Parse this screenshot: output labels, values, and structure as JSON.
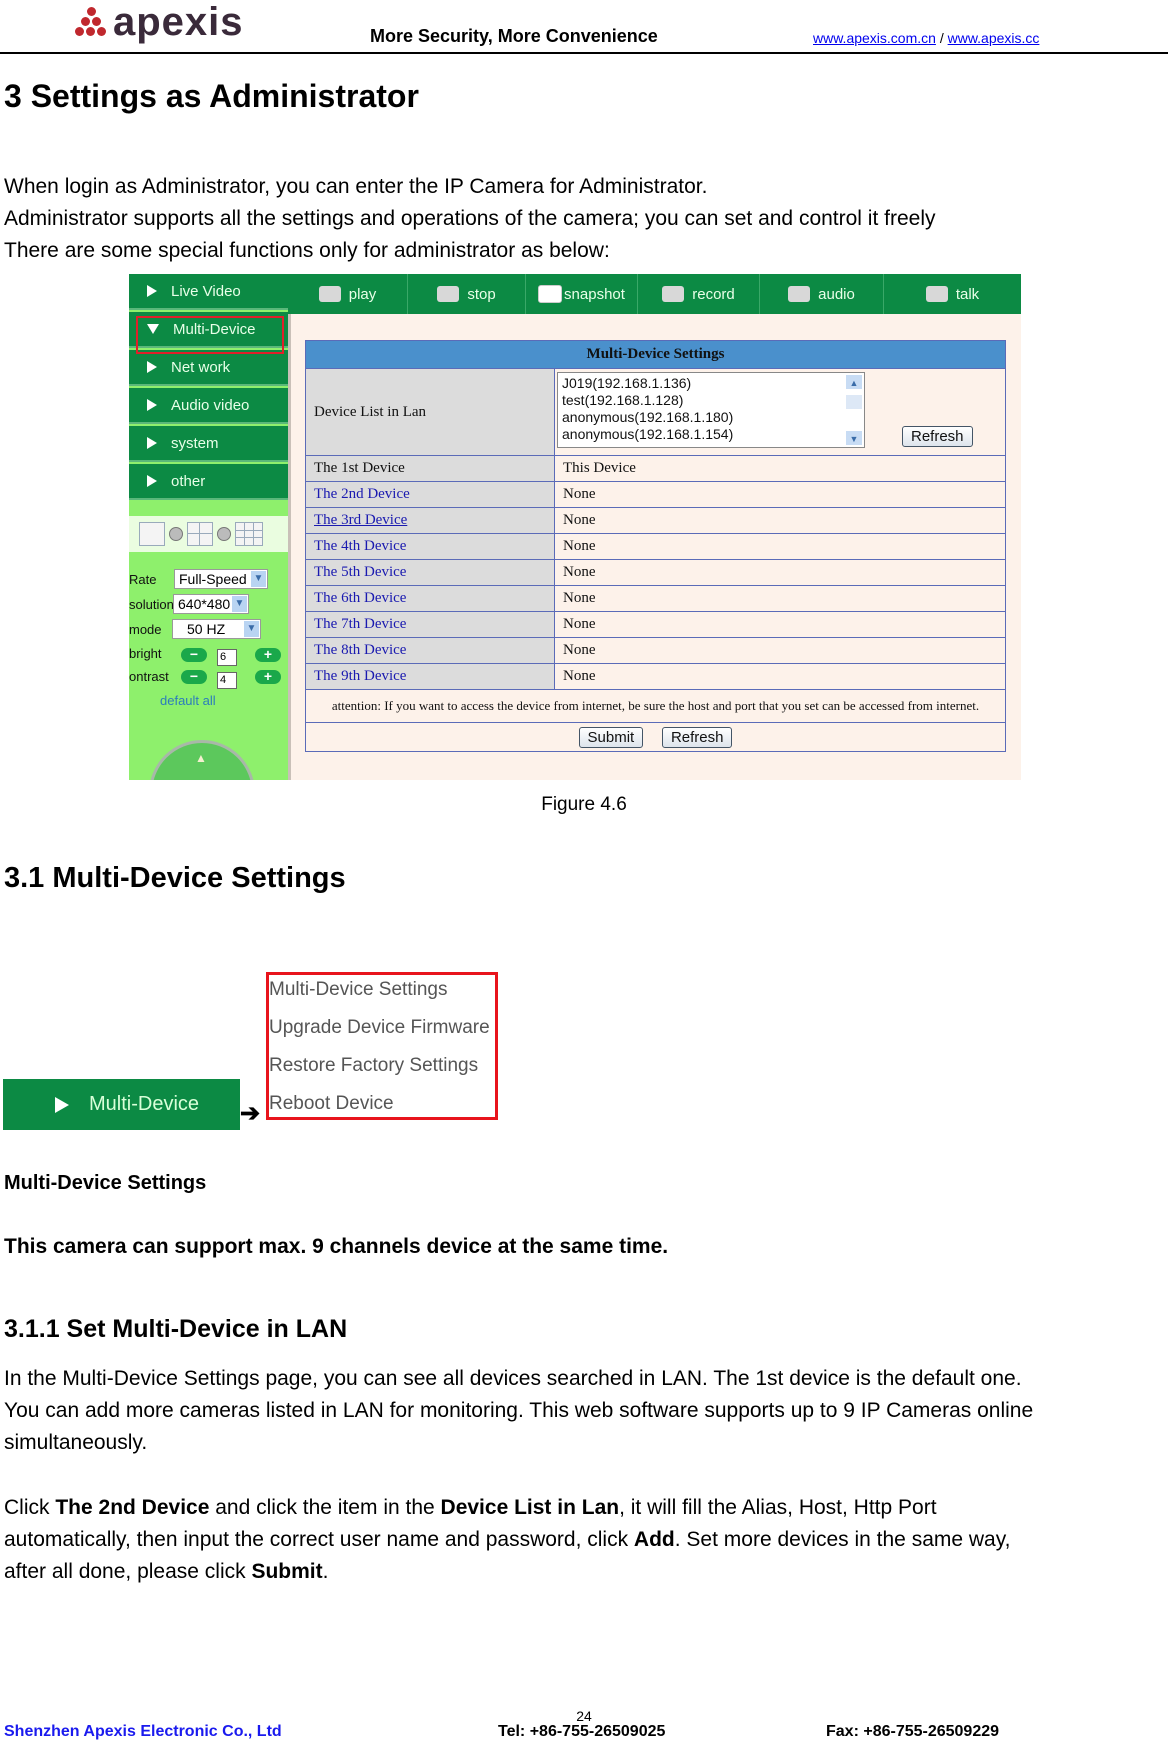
{
  "header": {
    "logo_text": "apexis",
    "tagline": "More Security, More Convenience",
    "link1": "www.apexis.com.cn",
    "separator": "/",
    "link2": "www.apexis.cc"
  },
  "section3": {
    "title": "3 Settings as Administrator",
    "lines": [
      "When login as Administrator, you can enter the IP Camera for Administrator.",
      "Administrator supports all the settings and operations of the camera; you can set and control it freely",
      "There are some special functions only for administrator as below:"
    ]
  },
  "figure": {
    "sidebar": [
      {
        "label": "Live Video",
        "icon": "triangle-right-icon"
      },
      {
        "label": "Multi-Device",
        "icon": "triangle-down-icon"
      },
      {
        "label": "Net work",
        "icon": "triangle-right-icon"
      },
      {
        "label": "Audio video",
        "icon": "triangle-right-icon"
      },
      {
        "label": "system",
        "icon": "triangle-right-icon"
      },
      {
        "label": "other",
        "icon": "triangle-right-icon"
      }
    ],
    "controls": {
      "rate_label": "Rate",
      "rate_value": "Full-Speed",
      "resolution_label": "solution",
      "resolution_value": "640*480",
      "mode_label": "mode",
      "mode_value": "50 HZ",
      "bright_label": "bright",
      "bright_value": "6",
      "contrast_label": "ontrast",
      "contrast_value": "4",
      "minus": "−",
      "plus": "+",
      "default_all": "default all"
    },
    "toolbar": [
      {
        "label": "play",
        "icon": "play-icon"
      },
      {
        "label": "stop",
        "icon": "stop-icon"
      },
      {
        "label": "snapshot",
        "icon": "camera-icon"
      },
      {
        "label": "record",
        "icon": "video-camera-icon"
      },
      {
        "label": "audio",
        "icon": "headphones-icon"
      },
      {
        "label": "talk",
        "icon": "microphone-icon"
      }
    ],
    "panel": {
      "title": "Multi-Device Settings",
      "device_list_label": "Device List in Lan",
      "device_list": [
        "J019(192.168.1.136)",
        "test(192.168.1.128)",
        "anonymous(192.168.1.180)",
        "anonymous(192.168.1.154)"
      ],
      "refresh_label": "Refresh",
      "devices": [
        {
          "name": "The 1st Device",
          "value": "This Device"
        },
        {
          "name": "The 2nd Device",
          "value": "None"
        },
        {
          "name": "The 3rd Device",
          "value": "None"
        },
        {
          "name": "The 4th Device",
          "value": "None"
        },
        {
          "name": "The 5th Device",
          "value": "None"
        },
        {
          "name": "The 6th Device",
          "value": "None"
        },
        {
          "name": "The 7th Device",
          "value": "None"
        },
        {
          "name": "The 8th Device",
          "value": "None"
        },
        {
          "name": "The 9th Device",
          "value": "None"
        }
      ],
      "attention": "attention: If you want to access the device from internet, be sure the host and port that you set can be accessed from internet.",
      "submit_label": "Submit",
      "refresh2_label": "Refresh"
    },
    "caption": "Figure 4.6"
  },
  "section31": {
    "title": "3.1 Multi-Device Settings",
    "button_label": "Multi-Device",
    "arrow": "➔",
    "menu": [
      "Multi-Device Settings",
      "Upgrade Device Firmware",
      "Restore Factory Settings",
      "Reboot Device"
    ],
    "subtitle": "Multi-Device Settings",
    "note": "This camera can support max. 9 channels device at the same time."
  },
  "section311": {
    "title": "3.1.1 Set Multi-Device in LAN",
    "para1": [
      "In the Multi-Device Settings page, you can see all devices searched in LAN. The 1st device is the default one.",
      "You can add more cameras listed in LAN for monitoring. This web software supports up to 9 IP Cameras online",
      "simultaneously."
    ],
    "para2": {
      "t1": "Click ",
      "b1": "The 2nd Device",
      "t2": " and click the item in the ",
      "b2": "Device List in Lan",
      "t3": ", it will fill the Alias, Host, Http Port",
      "t4": "automatically, then input the correct user name and password, click ",
      "b3": "Add",
      "t5": ". Set more devices in the same way,",
      "t6": "after all done, please click ",
      "b4": "Submit",
      "t7": "."
    }
  },
  "footer": {
    "page": "24",
    "company": "Shenzhen Apexis Electronic Co., Ltd",
    "tel": "Tel: +86-755-26509025",
    "fax": "Fax: +86-755-26509229"
  },
  "colors": {
    "green": "#0c8a44",
    "light_green": "#8ef06c",
    "table_header_blue": "#4a90cc",
    "link_blue": "#1a1ab0",
    "highlight_red": "#e0202a",
    "footer_blue": "#1a1aee"
  }
}
